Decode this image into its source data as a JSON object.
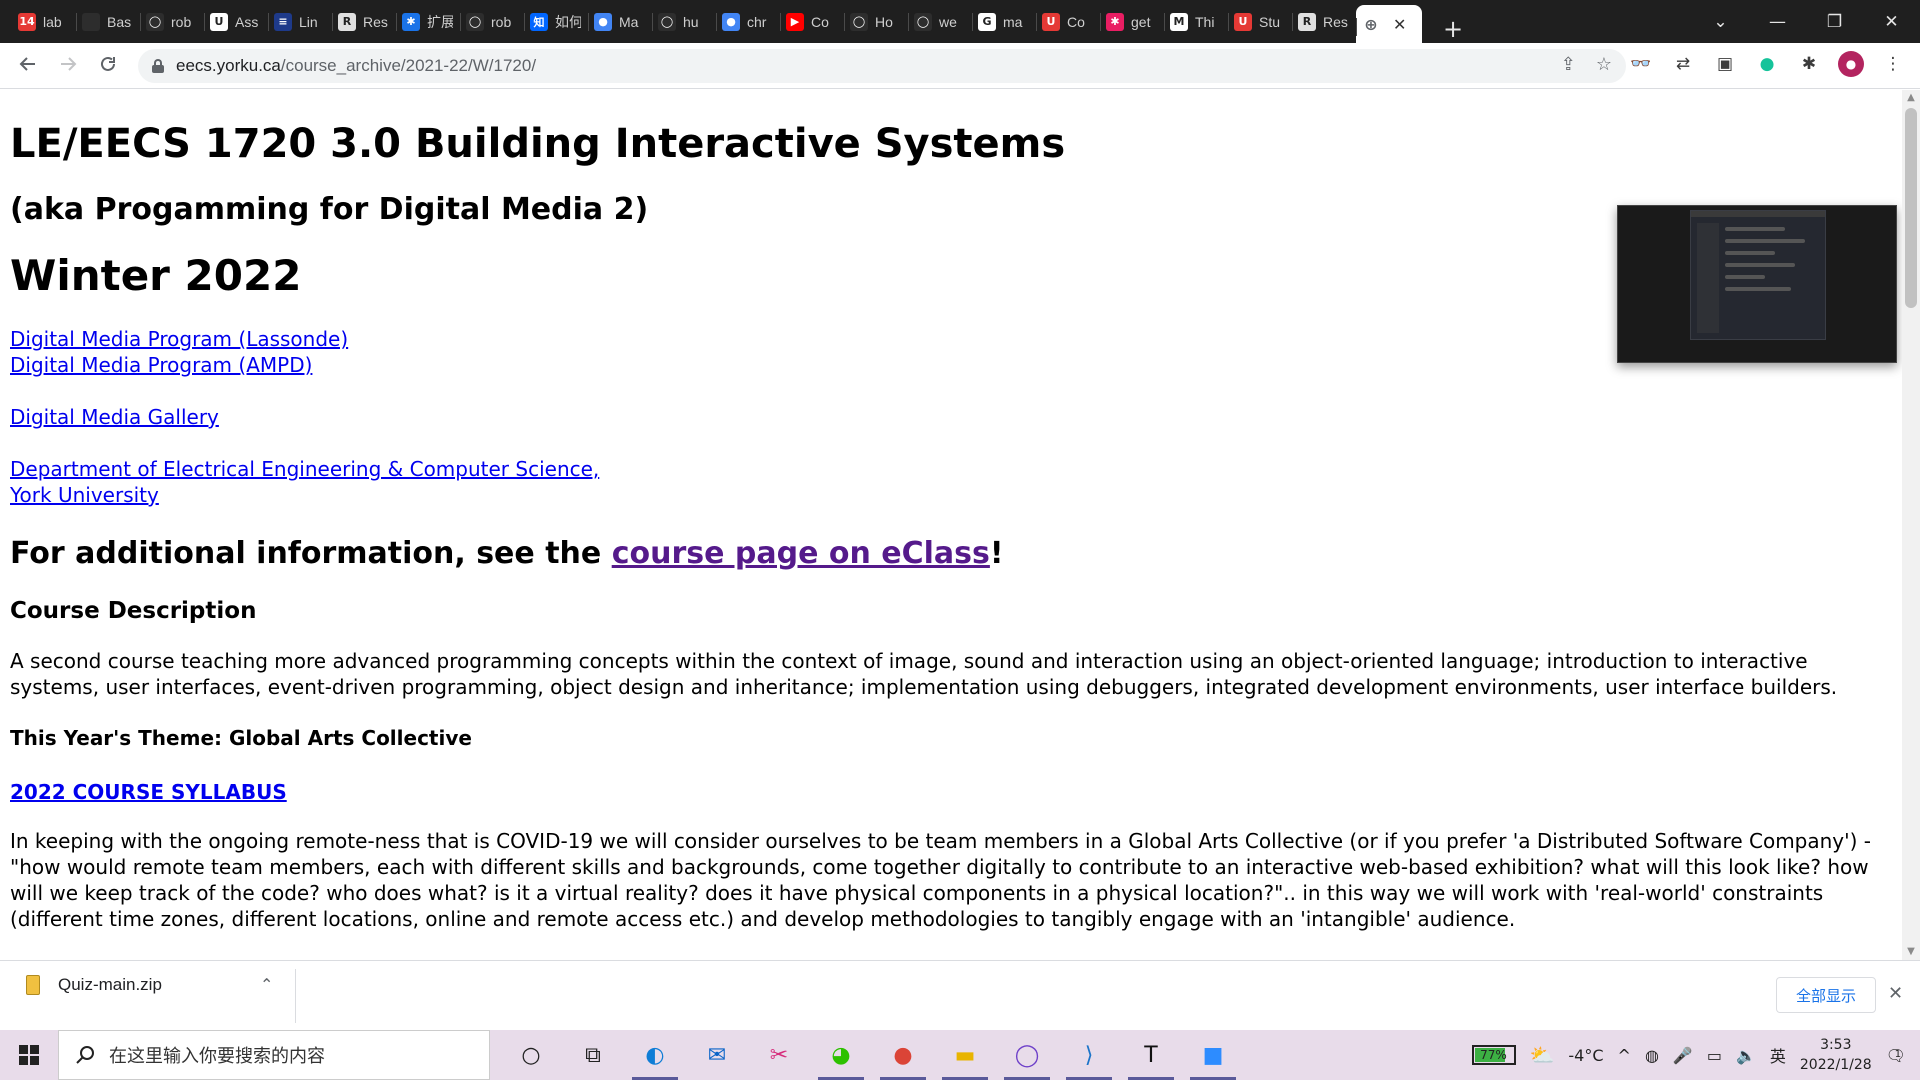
{
  "browser": {
    "tabs": [
      {
        "title": "lab",
        "icon": "badge-icon",
        "color": "#e53935",
        "glyph": "14"
      },
      {
        "title": "Bas",
        "icon": "dark-square-icon",
        "color": "#2d2d2d",
        "glyph": ""
      },
      {
        "title": "rob",
        "icon": "github-icon",
        "color": "#2d2d2d",
        "glyph": "◯"
      },
      {
        "title": "Ass",
        "icon": "u-logo-icon",
        "color": "#ffffff",
        "glyph": "U"
      },
      {
        "title": "Lin",
        "icon": "blue-lines-icon",
        "color": "#1e3a8a",
        "glyph": "≡"
      },
      {
        "title": "Res",
        "icon": "r-logo-icon",
        "color": "#e0e0e0",
        "glyph": "R"
      },
      {
        "title": "扩展",
        "icon": "puzzle-icon",
        "color": "#1a73e8",
        "glyph": "✱"
      },
      {
        "title": "rob",
        "icon": "github-icon",
        "color": "#2d2d2d",
        "glyph": "◯"
      },
      {
        "title": "如何",
        "icon": "zhihu-icon",
        "color": "#0066ff",
        "glyph": "知"
      },
      {
        "title": "Ma",
        "icon": "chrome-icon",
        "color": "#4285f4",
        "glyph": "●"
      },
      {
        "title": "hu",
        "icon": "github-icon",
        "color": "#2d2d2d",
        "glyph": "◯"
      },
      {
        "title": "chr",
        "icon": "chrome-icon",
        "color": "#4285f4",
        "glyph": "●"
      },
      {
        "title": "Co",
        "icon": "youtube-icon",
        "color": "#ff0000",
        "glyph": "▶"
      },
      {
        "title": "Ho",
        "icon": "github-icon",
        "color": "#2d2d2d",
        "glyph": "◯"
      },
      {
        "title": "we",
        "icon": "github-icon",
        "color": "#2d2d2d",
        "glyph": "◯"
      },
      {
        "title": "ma",
        "icon": "google-icon",
        "color": "#ffffff",
        "glyph": "G"
      },
      {
        "title": "Co",
        "icon": "u-red-icon",
        "color": "#e53935",
        "glyph": "U"
      },
      {
        "title": "get",
        "icon": "star-icon",
        "color": "#e91e63",
        "glyph": "✱"
      },
      {
        "title": "Thi",
        "icon": "gmail-icon",
        "color": "#ffffff",
        "glyph": "M"
      },
      {
        "title": "Stu",
        "icon": "u-red-icon",
        "color": "#e53935",
        "glyph": "U"
      },
      {
        "title": "Res",
        "icon": "r-logo-icon",
        "color": "#e0e0e0",
        "glyph": "R"
      }
    ],
    "active_tab": {
      "icon": "globe-icon",
      "close": "✕"
    },
    "new_tab": "+",
    "window_controls": {
      "dropdown": "⌄",
      "minimize": "—",
      "restore": "❐",
      "close": "✕"
    },
    "url_host": "eecs.yorku.ca",
    "url_path": "/course_archive/2021-22/W/1720/"
  },
  "page": {
    "title": "LE/EECS 1720 3.0 Building Interactive Systems",
    "subtitle": "(aka Progamming for Digital Media 2)",
    "term": "Winter 2022",
    "links": {
      "lassonde": "Digital Media Program (Lassonde)",
      "ampd": "Digital Media Program (AMPD)",
      "gallery": "Digital Media Gallery",
      "dept_line1": "Department of Electrical Engineering & Computer Science,",
      "dept_line2": "York University"
    },
    "more_info_prefix": "For additional information, see the ",
    "more_info_link": "course page on eClass",
    "more_info_suffix": "!",
    "course_desc_heading": "Course Description",
    "course_desc": "A second course teaching more advanced programming concepts within the context of image, sound and interaction using an object-oriented language; introduction to interactive systems, user interfaces, event-driven programming, object design and inheritance; implementation using debuggers, integrated development environments, user interface builders.",
    "theme_heading": "This Year's Theme: Global Arts Collective",
    "syllabus_link": "2022 COURSE SYLLABUS",
    "theme_body": "In keeping with the ongoing remote-ness that is COVID-19 we will consider ourselves to be team members in a Global Arts Collective (or if you prefer 'a Distributed Software Company') - \"how would remote team members, each with different skills and backgrounds, come together digitally to contribute to an interactive web-based exhibition? what will this look like? how will we keep track of the code? who does what? is it a virtual reality? does it have physical components in a physical location?\".. in this way we will work with 'real-world' constraints (different time zones, different locations, online and remote access etc.) and develop methodologies to tangibly engage with an 'intangible' audience."
  },
  "downloads": {
    "file": "Quiz-main.zip",
    "show_all": "全部显示",
    "close": "✕"
  },
  "taskbar": {
    "search_placeholder": "在这里输入你要搜索的内容",
    "apps": [
      {
        "name": "cortana-icon",
        "glyph": "○"
      },
      {
        "name": "task-view-icon",
        "glyph": "⧉"
      },
      {
        "name": "edge-icon",
        "glyph": "◐",
        "color": "#0f7dd6"
      },
      {
        "name": "mail-icon",
        "glyph": "✉",
        "color": "#0a64c8"
      },
      {
        "name": "snip-icon",
        "glyph": "✂",
        "color": "#d62b7b"
      },
      {
        "name": "wechat-icon",
        "glyph": "◕",
        "color": "#2dc100"
      },
      {
        "name": "chrome-taskbar-icon",
        "glyph": "●",
        "color": "#db4437"
      },
      {
        "name": "file-explorer-icon",
        "glyph": "▬",
        "color": "#e8b400"
      },
      {
        "name": "github-desktop-icon",
        "glyph": "◯",
        "color": "#6e40c9"
      },
      {
        "name": "vscode-icon",
        "glyph": "⟩",
        "color": "#1b74c9"
      },
      {
        "name": "typora-icon",
        "glyph": "T",
        "color": "#111111"
      },
      {
        "name": "zoom-icon",
        "glyph": "■",
        "color": "#2d8cff"
      }
    ],
    "battery": "77%",
    "battery_level": 0.77,
    "temperature": "-4°C",
    "ime": "英",
    "time": "3:53",
    "date": "2022/1/28",
    "notifications": "1"
  }
}
